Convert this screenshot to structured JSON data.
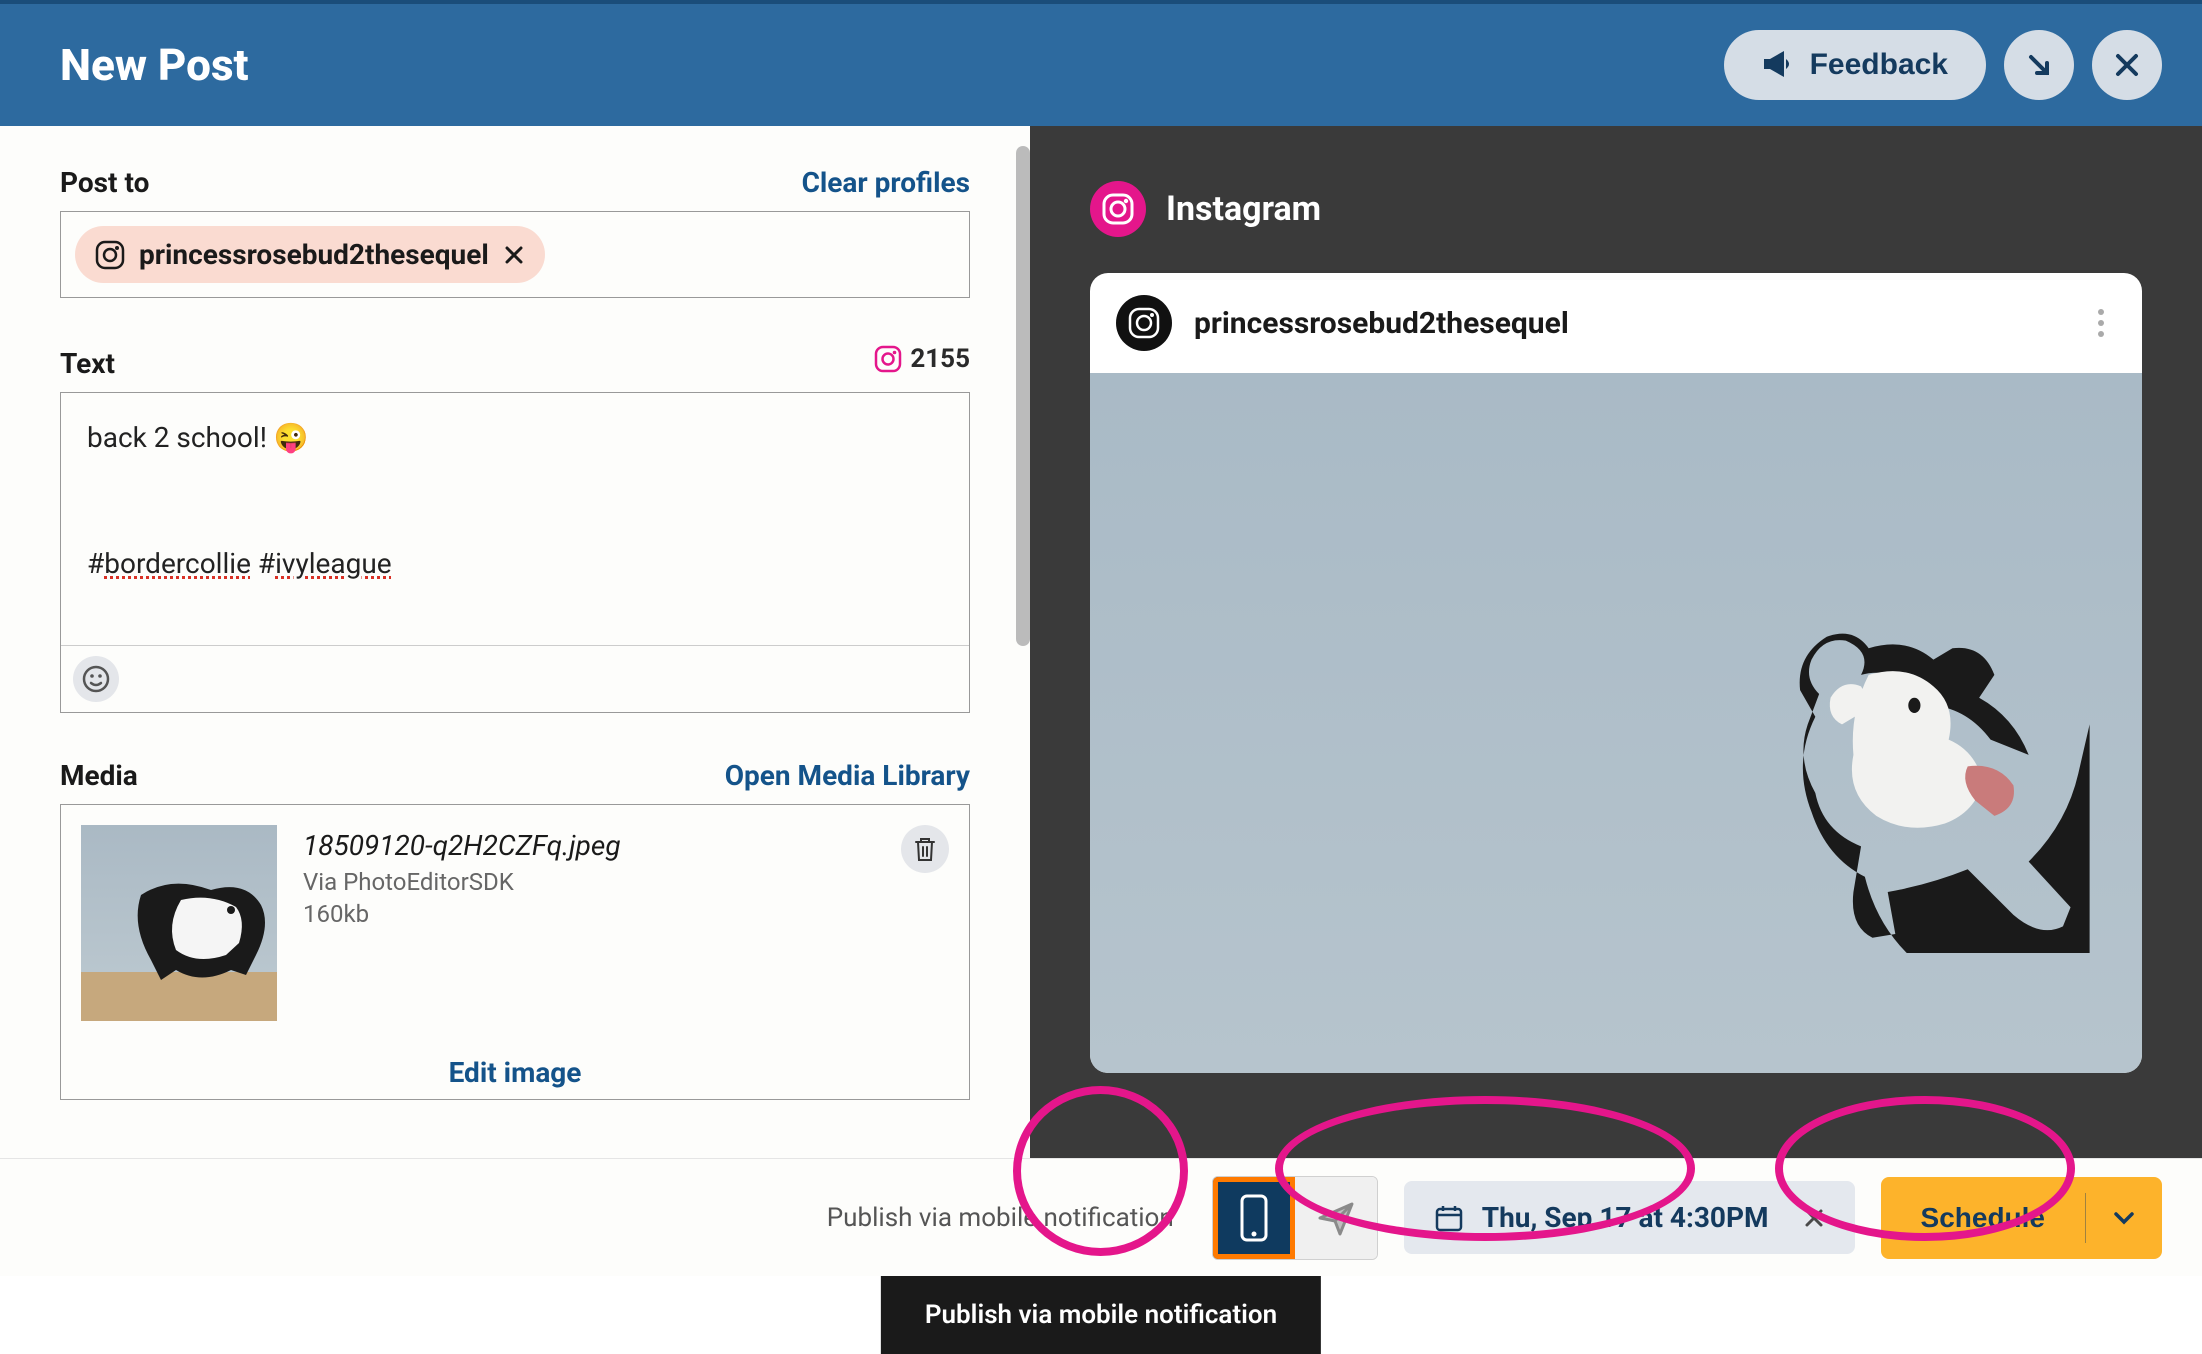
{
  "header": {
    "title": "New Post",
    "feedback_label": "Feedback"
  },
  "post_to": {
    "label": "Post to",
    "clear_link": "Clear profiles",
    "profile_name": "princessrosebud2thesequel"
  },
  "text_section": {
    "label": "Text",
    "char_count": "2155",
    "content_line1": "back 2 school! 😜",
    "content_line2_prefix": "#",
    "content_line2_word1": "bordercollie",
    "content_line2_mid": " #",
    "content_line2_word2": "ivyleague"
  },
  "media": {
    "label": "Media",
    "open_link": "Open Media Library",
    "filename": "18509120-q2H2CZFq.jpeg",
    "source": "Via PhotoEditorSDK",
    "size": "160kb",
    "edit_link": "Edit image"
  },
  "preview": {
    "platform": "Instagram",
    "username": "princessrosebud2thesequel"
  },
  "footer": {
    "publish_label": "Publish via mobile notification",
    "date_text": "Thu, Sep 17 at 4:30PM",
    "schedule_label": "Schedule",
    "tooltip": "Publish via mobile notification"
  }
}
